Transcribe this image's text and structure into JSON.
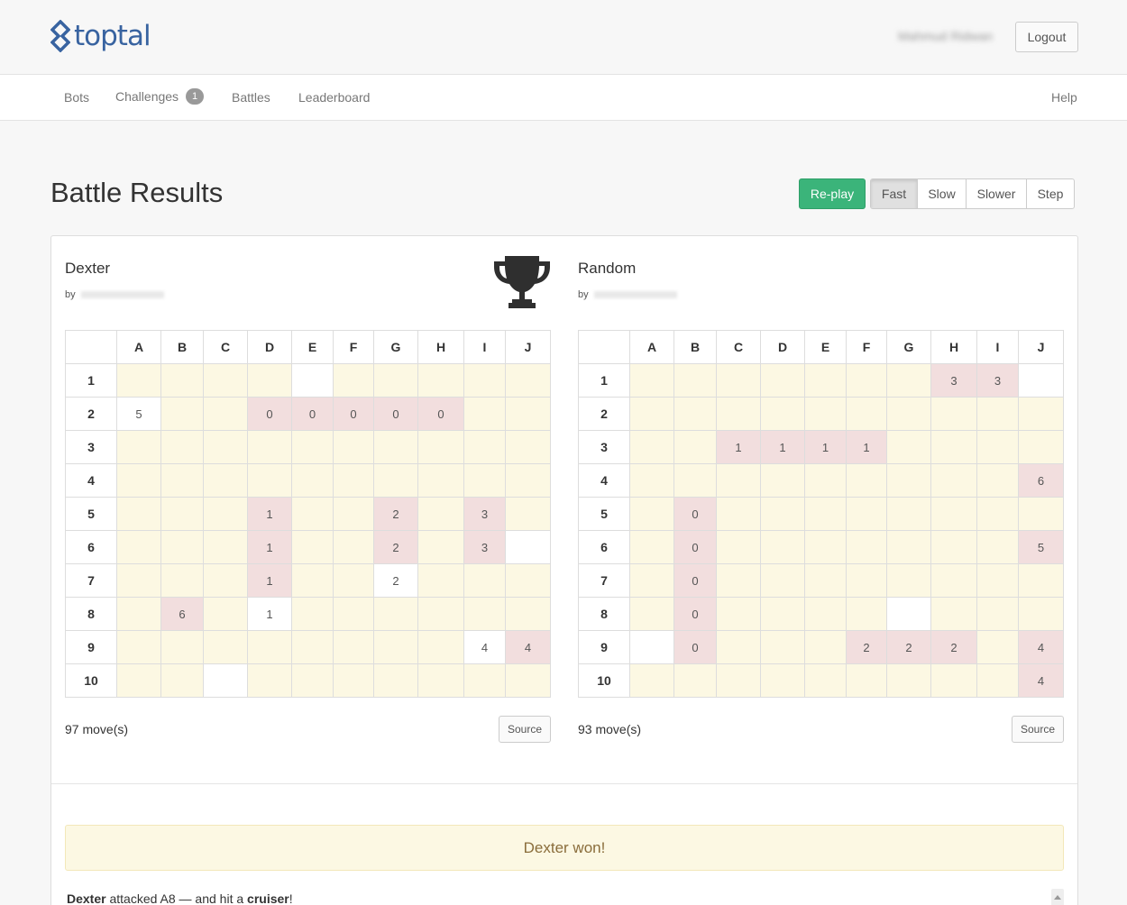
{
  "header": {
    "logo_text": "toptal",
    "username": "Mahmud Ridwan",
    "logout_label": "Logout"
  },
  "nav": {
    "items": [
      {
        "label": "Bots"
      },
      {
        "label": "Challenges",
        "badge": "1"
      },
      {
        "label": "Battles"
      },
      {
        "label": "Leaderboard"
      }
    ],
    "help_label": "Help"
  },
  "page": {
    "title": "Battle Results",
    "replay_label": "Re-play",
    "speeds": [
      "Fast",
      "Slow",
      "Slower",
      "Step"
    ],
    "active_speed": "Fast"
  },
  "columns": [
    "A",
    "B",
    "C",
    "D",
    "E",
    "F",
    "G",
    "H",
    "I",
    "J"
  ],
  "rows": [
    "1",
    "2",
    "3",
    "4",
    "5",
    "6",
    "7",
    "8",
    "9",
    "10"
  ],
  "players": [
    {
      "name": "Dexter",
      "by_label": "by",
      "winner": true,
      "moves": "97 move(s)",
      "source_label": "Source",
      "board": [
        [
          "e",
          "e",
          "e",
          "e",
          "m",
          "e",
          "e",
          "e",
          "e",
          "e"
        ],
        [
          "m5",
          "e",
          "e",
          "h0",
          "h0",
          "h0",
          "h0",
          "h0",
          "e",
          "e"
        ],
        [
          "e",
          "e",
          "e",
          "e",
          "e",
          "e",
          "e",
          "e",
          "e",
          "e"
        ],
        [
          "e",
          "e",
          "e",
          "e",
          "e",
          "e",
          "e",
          "e",
          "e",
          "e"
        ],
        [
          "e",
          "e",
          "e",
          "h1",
          "e",
          "e",
          "h2",
          "e",
          "h3",
          "e"
        ],
        [
          "e",
          "e",
          "e",
          "h1",
          "e",
          "e",
          "h2",
          "e",
          "h3",
          "m"
        ],
        [
          "e",
          "e",
          "e",
          "h1",
          "e",
          "e",
          "m2",
          "e",
          "e",
          "e"
        ],
        [
          "e",
          "h6",
          "e",
          "m1",
          "e",
          "e",
          "e",
          "e",
          "e",
          "e"
        ],
        [
          "e",
          "e",
          "e",
          "e",
          "e",
          "e",
          "e",
          "e",
          "m4",
          "h4"
        ],
        [
          "e",
          "e",
          "m",
          "e",
          "e",
          "e",
          "e",
          "e",
          "e",
          "e"
        ]
      ]
    },
    {
      "name": "Random",
      "by_label": "by",
      "winner": false,
      "moves": "93 move(s)",
      "source_label": "Source",
      "board": [
        [
          "e",
          "e",
          "e",
          "e",
          "e",
          "e",
          "e",
          "h3",
          "h3",
          "m"
        ],
        [
          "e",
          "e",
          "e",
          "e",
          "e",
          "e",
          "e",
          "e",
          "e",
          "e"
        ],
        [
          "e",
          "e",
          "h1",
          "h1",
          "h1",
          "h1",
          "e",
          "e",
          "e",
          "e"
        ],
        [
          "e",
          "e",
          "e",
          "e",
          "e",
          "e",
          "e",
          "e",
          "e",
          "h6"
        ],
        [
          "e",
          "h0",
          "e",
          "e",
          "e",
          "e",
          "e",
          "e",
          "e",
          "e"
        ],
        [
          "e",
          "h0",
          "e",
          "e",
          "e",
          "e",
          "e",
          "e",
          "e",
          "h5"
        ],
        [
          "e",
          "h0",
          "e",
          "e",
          "e",
          "e",
          "e",
          "e",
          "e",
          "e"
        ],
        [
          "e",
          "h0",
          "e",
          "e",
          "e",
          "e",
          "m",
          "e",
          "e",
          "e"
        ],
        [
          "m",
          "h0",
          "e",
          "e",
          "e",
          "h2",
          "h2",
          "h2",
          "e",
          "h4"
        ],
        [
          "e",
          "e",
          "e",
          "e",
          "e",
          "e",
          "e",
          "e",
          "e",
          "h4"
        ]
      ]
    }
  ],
  "result": {
    "message": "Dexter won!"
  },
  "log": {
    "attacker": "Dexter",
    "text_mid": " attacked A8 — and hit a ",
    "ship": "cruiser",
    "text_end": "!"
  }
}
